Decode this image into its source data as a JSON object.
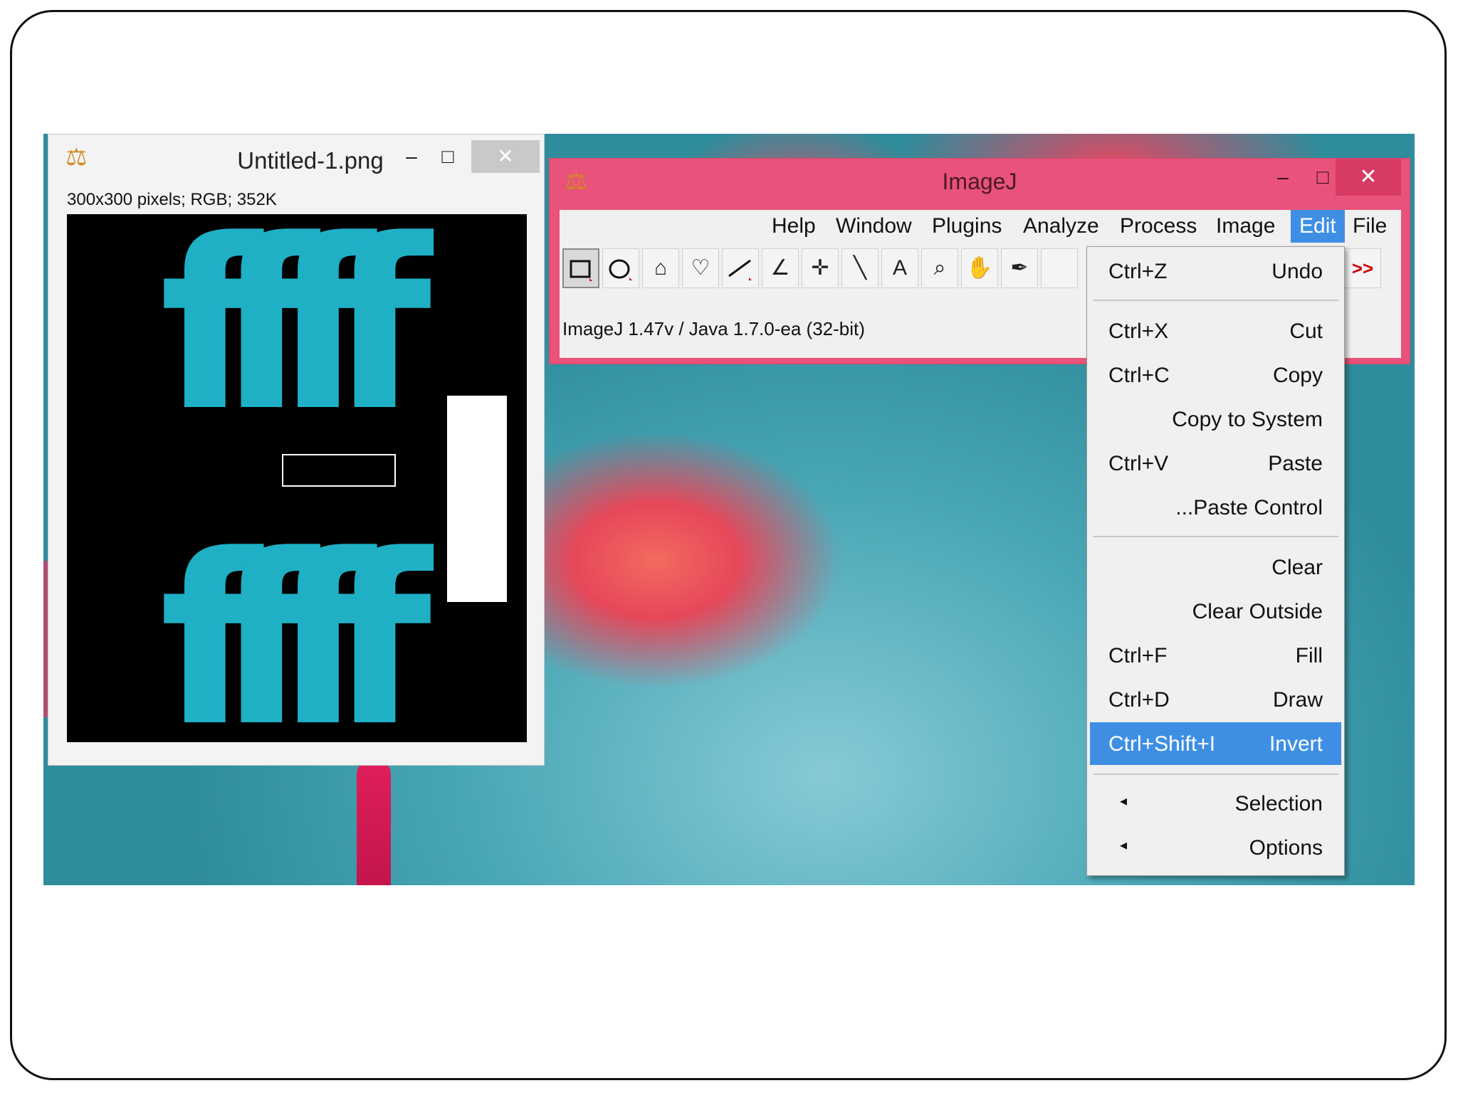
{
  "image_window": {
    "title": "Untitled-1.png",
    "info": "300x300 pixels; RGB; 352K",
    "minimize": "–",
    "maximize": "□",
    "close": "✕",
    "text_top": "ffff",
    "text_bottom": "ffff"
  },
  "imagej": {
    "title": "ImageJ",
    "minimize": "–",
    "maximize": "□",
    "close": "✕",
    "status": "ImageJ 1.47v / Java 1.7.0-ea (32-bit)",
    "menu": [
      "Help",
      "Window",
      "Plugins",
      "Analyze",
      "Process",
      "Image",
      "Edit",
      "File"
    ],
    "active_menu": "Edit",
    "more_tools": ">>",
    "tools": [
      "rectangle-icon",
      "oval-icon",
      "polygon-icon",
      "freehand-icon",
      "line-icon",
      "angle-icon",
      "point-icon",
      "wand-icon",
      "text-icon",
      "magnifier-icon",
      "hand-icon",
      "dropper-icon"
    ],
    "tool_glyphs": {
      "text": "A",
      "polygon": "⌂",
      "freehand": "♡",
      "angle": "∠",
      "point": "✛",
      "wand": "╲",
      "magnifier": "⌕",
      "hand": "✋",
      "dropper": "✒"
    }
  },
  "edit_menu": {
    "items": [
      {
        "shortcut": "Ctrl+Z",
        "label": "Undo"
      },
      {
        "shortcut": "Ctrl+X",
        "label": "Cut"
      },
      {
        "shortcut": "Ctrl+C",
        "label": "Copy"
      },
      {
        "shortcut": "",
        "label": "Copy to System"
      },
      {
        "shortcut": "Ctrl+V",
        "label": "Paste"
      },
      {
        "shortcut": "",
        "label": "...Paste Control"
      },
      {
        "shortcut": "",
        "label": "Clear"
      },
      {
        "shortcut": "",
        "label": "Clear Outside"
      },
      {
        "shortcut": "Ctrl+F",
        "label": "Fill"
      },
      {
        "shortcut": "Ctrl+D",
        "label": "Draw"
      },
      {
        "shortcut": "Ctrl+Shift+I",
        "label": "Invert"
      },
      {
        "shortcut": "",
        "label": "Selection",
        "submenu": true
      },
      {
        "shortcut": "",
        "label": "Options",
        "submenu": true
      }
    ],
    "highlighted": "Invert",
    "submenu_arrow": "◂"
  },
  "colors": {
    "accent": "#3e8fe4",
    "imagej_titlebar": "#e9527a",
    "text_color": "#1fb0c6"
  }
}
